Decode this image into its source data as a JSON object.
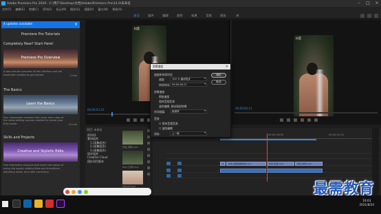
{
  "titlebar": {
    "title": "Adobe Premiere Pro 2020 - C:\\用户\\Desktop\\文档\\Adobe\\Premiere Pro\\14.0\\未命名"
  },
  "menu": [
    "文件(F)",
    "编辑(E)",
    "剪辑(C)",
    "序列(S)",
    "标记(M)",
    "图形(G)",
    "视图(V)",
    "窗口(W)",
    "帮助(H)"
  ],
  "workspace_tabs": [
    "学习",
    "组件",
    "编辑",
    "颜色",
    "效果",
    "音频",
    "图形",
    "库"
  ],
  "learn": {
    "banner": "4 updates available",
    "title": "Premiere Pro Tutorials",
    "section1": "Completely New? Start Here!",
    "tutorial1": {
      "title": "Premiere Pro Overview",
      "desc": "A two-minute overview of the interface and the essentials needed to get started.",
      "duration": "2 min"
    },
    "section2": "The Basics",
    "tutorial2": {
      "title": "Learn the Basics",
      "desc": "Four interactive tutorials that cover each step of the video editing process needed to create your first movie.",
      "duration": "15 min"
    },
    "section3": "Skills and Projects",
    "tutorial3": {
      "title": "Creative and Stylistic Edits",
      "desc": "Five interactive tutorials that teach the basics of using clip speed, adding titles and transitions, adjusting audio, and color correction."
    }
  },
  "source_monitor": {
    "brand": "抖音",
    "timecode": "00;00;03;10"
  },
  "program_monitor": {
    "brand": "抖音",
    "timecode": "00;00;04;11"
  },
  "project": {
    "header": "项目: 未命名",
    "tree": [
      "序列01",
      "素材组合",
      "1.(采集组合)",
      "2.(采集组合)",
      "3.(采集组合)",
      "同步组合",
      "Creative Cloud",
      "团队项目版本"
    ],
    "media_labels": [
      "抖音_剪辑.mp4",
      "Ham_抖音.mp4",
      "pdmvtl.mp4"
    ]
  },
  "timeline": {
    "seq_name": "序列01",
    "ruler": [
      "00;00",
      "00;00;16;00",
      "00;00;32;00"
    ],
    "clip_labels": [
      "fx",
      "抖音_视频编辑剪辑.mp4",
      "抖音_视频编辑剪辑.mp4",
      "抖音_剪辑.mp4",
      "抖音_剪辑.mp4"
    ]
  },
  "dialog": {
    "title": "剪辑速度",
    "section1": "速度和持续时间",
    "speed_label": "速度:",
    "speed_value": "100 % 保持同步",
    "duration_label": "持续时间:",
    "duration_value": "00;00;04;11",
    "section2": "剪辑速度",
    "reverse": "倒放速度",
    "keep_pitch": "保持音频音调",
    "ripple": "波纹编辑, 移动尾部剪辑",
    "interp_label": "时间插值:",
    "interp_value": "帧采样",
    "section3": "音频",
    "audio1": "☐ 保持音频音调",
    "audio2": "☐ 波纹编辑",
    "render_label": "渲染:",
    "render_value": "上一帧",
    "ok": "确定",
    "cancel": "取消"
  },
  "watermark": "最需教育",
  "taskbar": {
    "time": "19:03",
    "date": "2021/8/24"
  },
  "colors": {
    "accent": "#1473e6",
    "playhead": "#ff3c3c",
    "clip": "#6d7fb3",
    "watermark": "#2459b8"
  }
}
